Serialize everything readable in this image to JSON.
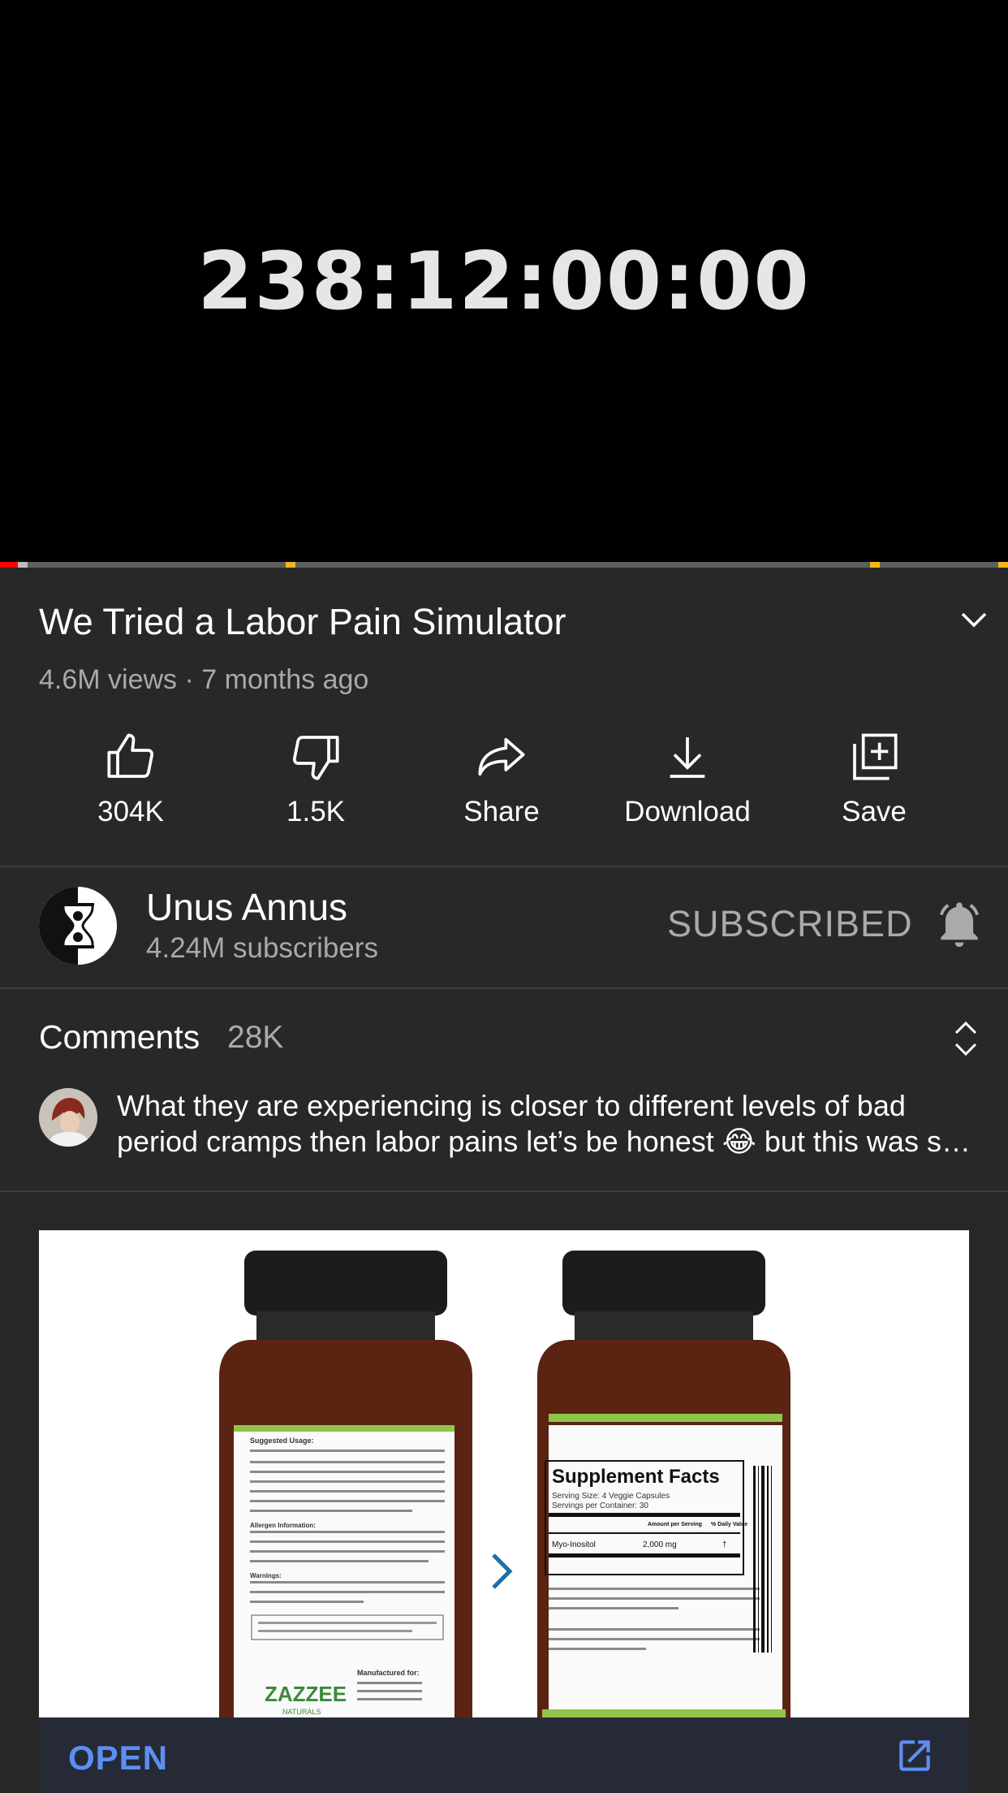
{
  "player": {
    "display_text": "238:12:00:00"
  },
  "video": {
    "title": "We Tried a Labor Pain Simulator",
    "meta": "4.6M views · 7 months ago"
  },
  "actions": {
    "like": "304K",
    "dislike": "1.5K",
    "share": "Share",
    "download": "Download",
    "save": "Save"
  },
  "channel": {
    "name": "Unus Annus",
    "subscribers": "4.24M subscribers",
    "subscribe_state": "SUBSCRIBED"
  },
  "comments": {
    "heading": "Comments",
    "count": "28K",
    "top_comment_line1": "What they are experiencing is closer to different levels of bad",
    "top_comment_line2": "period cramps then labor pains let’s be honest 😂 but this was s…"
  },
  "ad": {
    "cta": "OPEN",
    "image_text": {
      "brand": "ZAZZEE",
      "brand_sub": "NATURALS",
      "panel_title": "Supplement Facts",
      "serving_size": "Serving Size: 4 Veggie Capsules",
      "servings": "Servings per Container: 30",
      "col_amount": "Amount per Serving",
      "col_dv": "% Daily Value",
      "ingredient": "Myo-Inositol",
      "amount": "2,000 mg",
      "dv": "†",
      "usage_head": "Suggested Usage:",
      "allergen_head": "Allergen Information:",
      "warnings_head": "Warnings:",
      "manufacturer": "Manufactured for:"
    }
  },
  "colors": {
    "background": "#282828",
    "progress_played": "#ff0000",
    "ad_marker": "#f2b81a",
    "link_blue": "#5d8ff2"
  }
}
